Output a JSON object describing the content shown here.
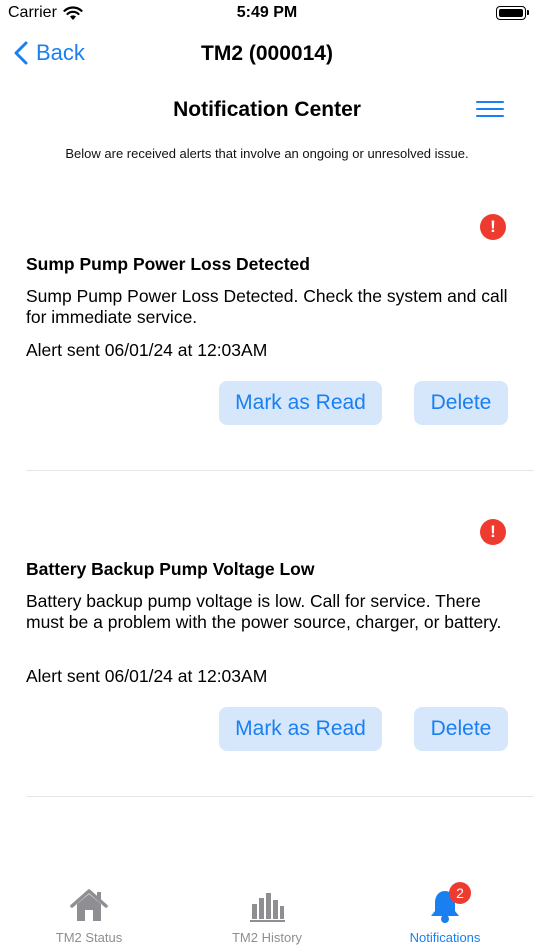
{
  "status_bar": {
    "carrier": "Carrier",
    "time": "5:49 PM"
  },
  "nav": {
    "back_label": "Back",
    "title": "TM2 (000014)"
  },
  "header": {
    "title": "Notification Center",
    "subtitle": "Below are received alerts that involve an ongoing or unresolved issue."
  },
  "notifications": [
    {
      "alert_glyph": "!",
      "title": "Sump Pump Power Loss Detected",
      "body": "Sump Pump Power Loss Detected. Check the system and call for immediate service.",
      "sent": "Alert sent 06/01/24 at 12:03AM",
      "mark_read_label": "Mark as Read",
      "delete_label": "Delete"
    },
    {
      "alert_glyph": "!",
      "title": "Battery Backup Pump Voltage Low",
      "body": "Battery backup pump voltage is low. Call for service. There must be a problem with the power source, charger, or battery.",
      "sent": "Alert sent 06/01/24 at 12:03AM",
      "mark_read_label": "Mark as Read",
      "delete_label": "Delete"
    }
  ],
  "tabs": [
    {
      "label": "TM2 Status",
      "icon": "house-icon"
    },
    {
      "label": "TM2 History",
      "icon": "bar-chart-icon"
    },
    {
      "label": "Notifications",
      "icon": "bell-icon",
      "badge": "2",
      "active": true
    }
  ],
  "colors": {
    "accent": "#1a7ff0",
    "alert": "#ee3b30",
    "button_bg": "#d6e7fb",
    "tab_inactive": "#8e8e93"
  }
}
